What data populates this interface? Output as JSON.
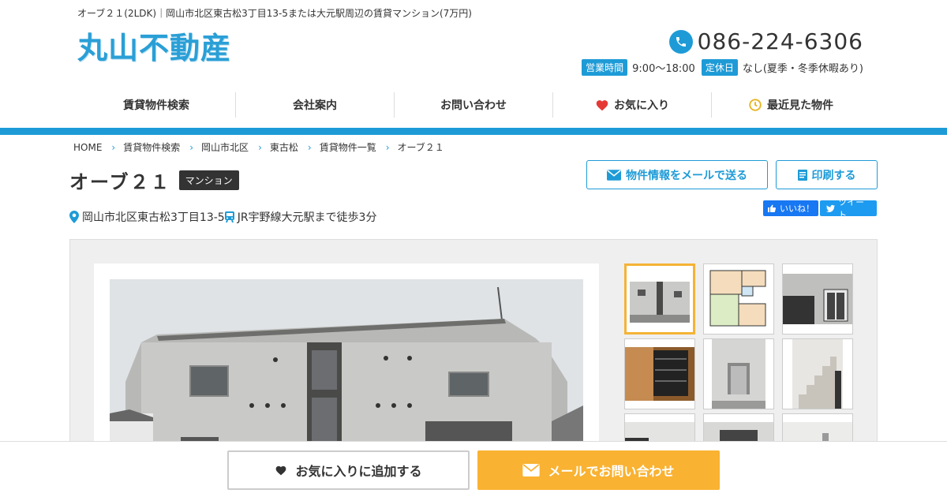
{
  "header": {
    "description": "オーブ２１(2LDK)｜岡山市北区東古松3丁目13-5または大元駅周辺の賃貸マンション(7万円)",
    "logo": "丸山不動産",
    "phone": "086-224-6306",
    "hours_label": "営業時間",
    "hours_value": "9:00〜18:00",
    "closed_label": "定休日",
    "closed_value": "なし(夏季・冬季休暇あり)"
  },
  "nav": {
    "items": [
      {
        "label": "賃貸物件検索"
      },
      {
        "label": "会社案内"
      },
      {
        "label": "お問い合わせ"
      },
      {
        "label": "お気に入り"
      },
      {
        "label": "最近見た物件"
      }
    ]
  },
  "breadcrumb": [
    "HOME",
    "賃貸物件検索",
    "岡山市北区",
    "東古松",
    "賃貸物件一覧",
    "オーブ２１"
  ],
  "property": {
    "title": "オーブ２１",
    "type": "マンション",
    "address": "岡山市北区東古松3丁目13-5",
    "access": "JR宇野線大元駅まで徒歩3分"
  },
  "actions": {
    "mail_label": "物件情報をメールで送る",
    "print_label": "印刷する",
    "like_label": "いいね！",
    "tweet_label": "ツイート"
  },
  "bottom": {
    "favorite_label": "お気に入りに追加する",
    "contact_label": "メールでお問い合わせ"
  },
  "colors": {
    "accent": "#1e9bd7",
    "cta": "#f9b231",
    "active_thumb": "#f5b335"
  }
}
